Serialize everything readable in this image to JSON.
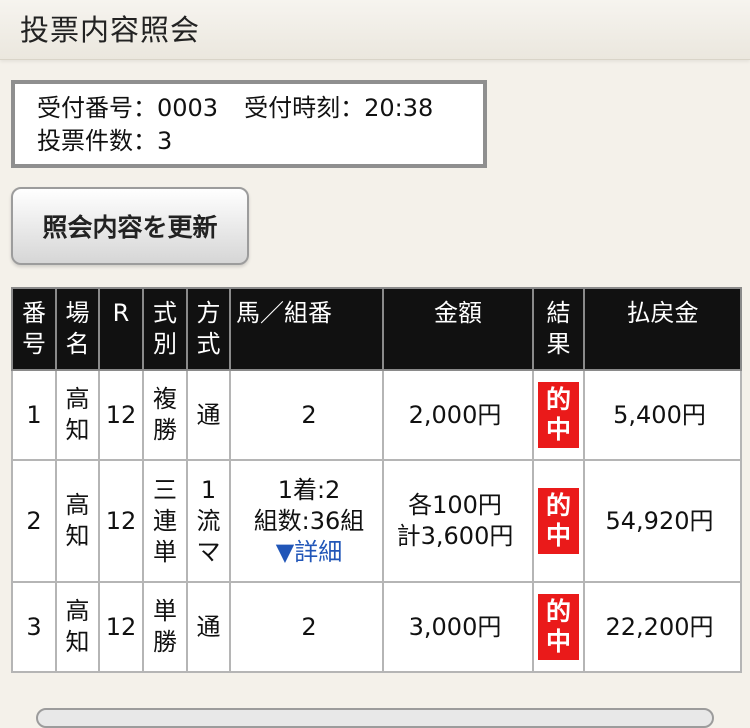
{
  "header": {
    "title": "投票内容照会"
  },
  "info": {
    "receipt_number": "受付番号：0003",
    "receipt_time": "受付時刻：20:38",
    "vote_count": "投票件数：3"
  },
  "refresh_button": {
    "label": "照会内容を更新"
  },
  "table": {
    "headers": {
      "number": [
        "番",
        "号"
      ],
      "venue": [
        "場",
        "名"
      ],
      "race": "R",
      "bet_type": [
        "式",
        "別"
      ],
      "method": [
        "方",
        "式"
      ],
      "horse": "馬／組番",
      "amount": "金額",
      "result": [
        "結",
        "果"
      ],
      "payout": "払戻金"
    },
    "rows": [
      {
        "number": "1",
        "venue": [
          "高",
          "知"
        ],
        "race": "12",
        "bet_type": [
          "複",
          "勝"
        ],
        "method": [
          "通"
        ],
        "horse": [
          "2"
        ],
        "detail": "",
        "amount": [
          "2,000円"
        ],
        "result": [
          "的",
          "中"
        ],
        "payout": "5,400円"
      },
      {
        "number": "2",
        "venue": [
          "高",
          "知"
        ],
        "race": "12",
        "bet_type": [
          "三",
          "連",
          "単"
        ],
        "method": [
          "1",
          "流",
          "マ"
        ],
        "horse": [
          "1着:2",
          "組数:36組"
        ],
        "detail": "▼詳細",
        "amount": [
          "各100円",
          "計3,600円"
        ],
        "result": [
          "的",
          "中"
        ],
        "payout": "54,920円"
      },
      {
        "number": "3",
        "venue": [
          "高",
          "知"
        ],
        "race": "12",
        "bet_type": [
          "単",
          "勝"
        ],
        "method": [
          "通"
        ],
        "horse": [
          "2"
        ],
        "detail": "",
        "amount": [
          "3,000円"
        ],
        "result": [
          "的",
          "中"
        ],
        "payout": "22,200円"
      }
    ]
  },
  "colors": {
    "header_bg": "#111111",
    "hit_badge": "#ea1a1a",
    "link": "#2156b8"
  }
}
